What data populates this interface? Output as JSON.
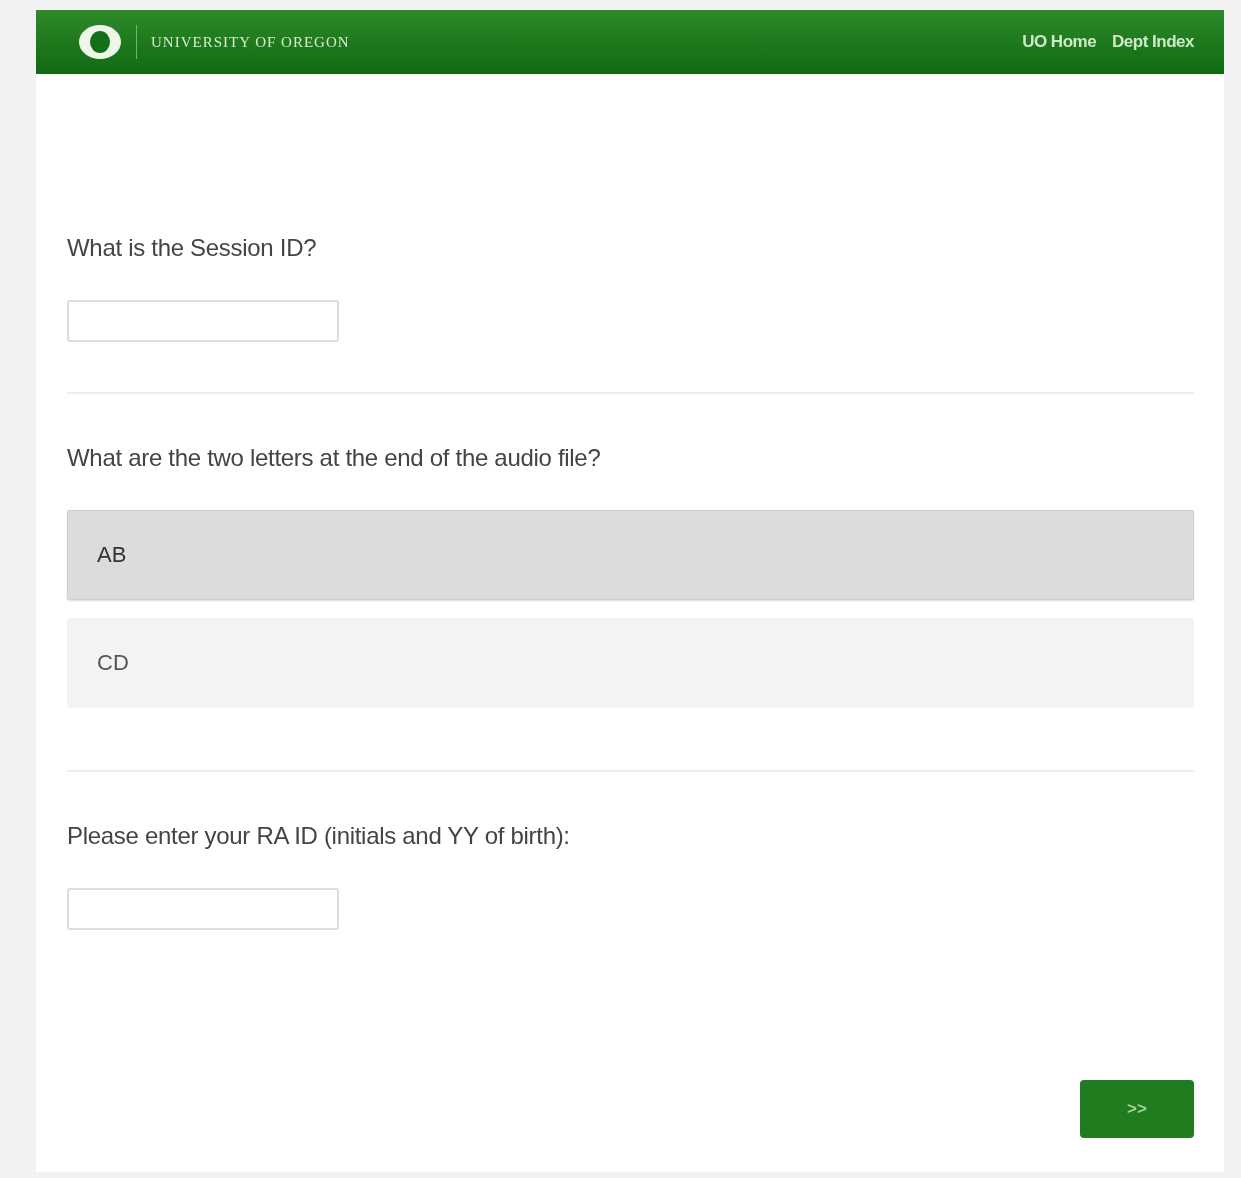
{
  "header": {
    "wordmark": "UNIVERSITY OF OREGON",
    "links": [
      "UO Home",
      "Dept Index"
    ]
  },
  "questions": [
    {
      "kind": "text",
      "prompt": "What is the Session ID?"
    },
    {
      "kind": "choice",
      "prompt": "What are the two letters at the end of the audio file?",
      "options": [
        {
          "label": "AB",
          "selected": true
        },
        {
          "label": "CD",
          "selected": false
        }
      ]
    },
    {
      "kind": "text",
      "prompt": "Please enter your RA ID (initials and YY of birth):"
    }
  ],
  "next_button": ">>"
}
